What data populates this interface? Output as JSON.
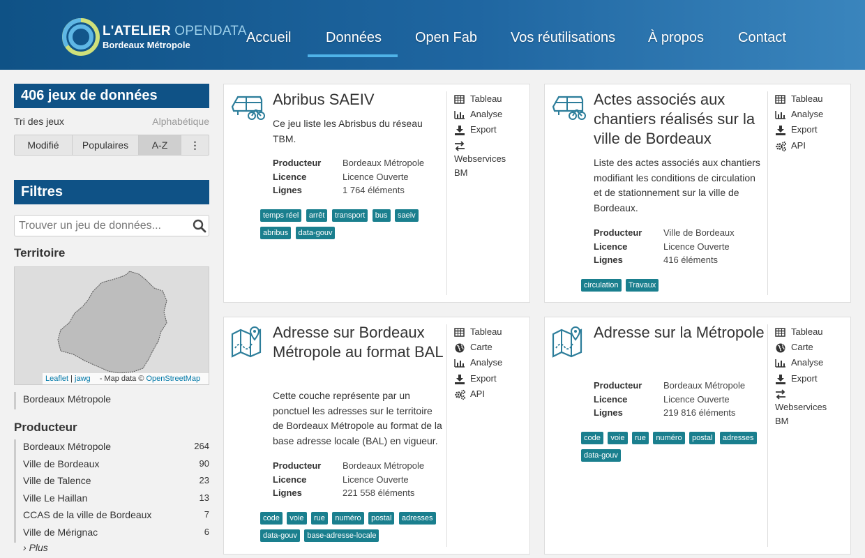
{
  "header": {
    "logo_title_main": "L'ATELIER ",
    "logo_title_accent": "OPENDATA",
    "logo_subtitle": "Bordeaux Métropole",
    "nav": [
      "Accueil",
      "Données",
      "Open Fab",
      "Vos réutilisations",
      "À propos",
      "Contact"
    ],
    "active_nav": "Données",
    "accent_color": "#4fb3e8"
  },
  "sidebar": {
    "dataset_count": "406 jeux de données",
    "sort_label": "Tri des jeux",
    "sort_value": "Alphabétique",
    "sort_buttons": [
      "Modifié",
      "Populaires",
      "A-Z",
      "⋮"
    ],
    "sort_active": "A-Z",
    "filters_title": "Filtres",
    "search_placeholder": "Trouver un jeu de données...",
    "territoire_title": "Territoire",
    "map_attribution": {
      "leaflet": "Leaflet",
      "sep": " | ",
      "jawg": "jawg",
      "mapdata": " - Map data © ",
      "osm": "OpenStreetMap"
    },
    "territoire_items": [
      "Bordeaux Métropole"
    ],
    "producteur_title": "Producteur",
    "producteur_items": [
      {
        "label": "Bordeaux Métropole",
        "count": "264"
      },
      {
        "label": "Ville de Bordeaux",
        "count": "90"
      },
      {
        "label": "Ville de Talence",
        "count": "23"
      },
      {
        "label": "Ville Le Haillan",
        "count": "13"
      },
      {
        "label": "CCAS de la ville de Bordeaux",
        "count": "7"
      },
      {
        "label": "Ville de Mérignac",
        "count": "6"
      }
    ],
    "more_label": "Plus"
  },
  "labels": {
    "producteur": "Producteur",
    "licence": "Licence",
    "lignes": "Lignes"
  },
  "cards": [
    {
      "title": "Abribus SAEIV",
      "description": "Ce jeu liste les Abrisbus du réseau TBM.",
      "producteur": "Bordeaux Métropole",
      "licence": "Licence Ouverte",
      "lignes": "1 764 éléments",
      "tags": [
        "temps réel",
        "arrêt",
        "transport",
        "bus",
        "saeiv",
        "abribus",
        "data-gouv"
      ],
      "actions": [
        "Tableau",
        "Analyse",
        "Export",
        "Webservices BM"
      ]
    },
    {
      "title": "Actes associés aux chantiers réalisés sur la ville de Bordeaux",
      "description": "Liste des actes associés aux chantiers modifiant les conditions de circulation et de stationnement sur la ville de Bordeaux.",
      "producteur": "Ville de Bordeaux",
      "licence": "Licence Ouverte",
      "lignes": "416 éléments",
      "tags": [
        "circulation",
        "Travaux"
      ],
      "actions": [
        "Tableau",
        "Analyse",
        "Export",
        "API"
      ]
    },
    {
      "title": "Adresse sur Bordeaux Métropole au format BAL",
      "description": "Cette couche représente par un ponctuel les adresses sur le territoire de Bordeaux Métropole au format de la base adresse locale (BAL) en vigueur.",
      "producteur": "Bordeaux Métropole",
      "licence": "Licence Ouverte",
      "lignes": "221 558 éléments",
      "tags": [
        "code",
        "voie",
        "rue",
        "numéro",
        "postal",
        "adresses",
        "data-gouv",
        "base-adresse-locale"
      ],
      "actions": [
        "Tableau",
        "Carte",
        "Analyse",
        "Export",
        "API"
      ]
    },
    {
      "title": "Adresse sur la Métropole",
      "description": "",
      "producteur": "Bordeaux Métropole",
      "licence": "Licence Ouverte",
      "lignes": "219 816 éléments",
      "tags": [
        "code",
        "voie",
        "rue",
        "numéro",
        "postal",
        "adresses",
        "data-gouv"
      ],
      "actions": [
        "Tableau",
        "Carte",
        "Analyse",
        "Export",
        "Webservices BM"
      ]
    }
  ],
  "colors": {
    "header_dark": "#0f5286",
    "tag": "#1a7f8e",
    "icon_teal": "#2c7d9a"
  }
}
